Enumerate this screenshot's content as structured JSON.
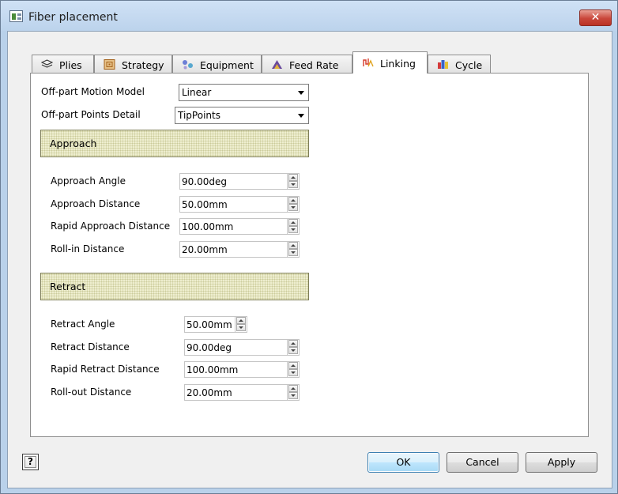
{
  "window": {
    "title": "Fiber placement",
    "close_label": "✕"
  },
  "tabs": [
    {
      "label": "Plies",
      "icon": "plies-icon",
      "active": false
    },
    {
      "label": "Strategy",
      "icon": "strategy-icon",
      "active": false
    },
    {
      "label": "Equipment",
      "icon": "equipment-icon",
      "active": false
    },
    {
      "label": "Feed Rate",
      "icon": "feed-rate-icon",
      "active": false
    },
    {
      "label": "Linking",
      "icon": "linking-icon",
      "active": true
    },
    {
      "label": "Cycle",
      "icon": "cycle-icon",
      "active": false
    }
  ],
  "linking": {
    "motion_model_label": "Off-part Motion Model",
    "motion_model_value": "Linear",
    "points_detail_label": "Off-part Points Detail",
    "points_detail_value": "TipPoints",
    "approach": {
      "title": "Approach",
      "fields": [
        {
          "label": "Approach Angle",
          "value": "90.00deg"
        },
        {
          "label": "Approach Distance",
          "value": "50.00mm"
        },
        {
          "label": "Rapid Approach Distance",
          "value": "100.00mm"
        },
        {
          "label": "Roll-in Distance",
          "value": "20.00mm"
        }
      ]
    },
    "retract": {
      "title": "Retract",
      "fields": [
        {
          "label": "Retract Angle",
          "value": "50.00mm"
        },
        {
          "label": "Retract  Distance",
          "value": "90.00deg"
        },
        {
          "label": "Rapid Retract Distance",
          "value": "100.00mm"
        },
        {
          "label": "Roll-out Distance",
          "value": "20.00mm"
        }
      ]
    }
  },
  "footer": {
    "help_label": "?",
    "ok_label": "OK",
    "cancel_label": "Cancel",
    "apply_label": "Apply"
  }
}
